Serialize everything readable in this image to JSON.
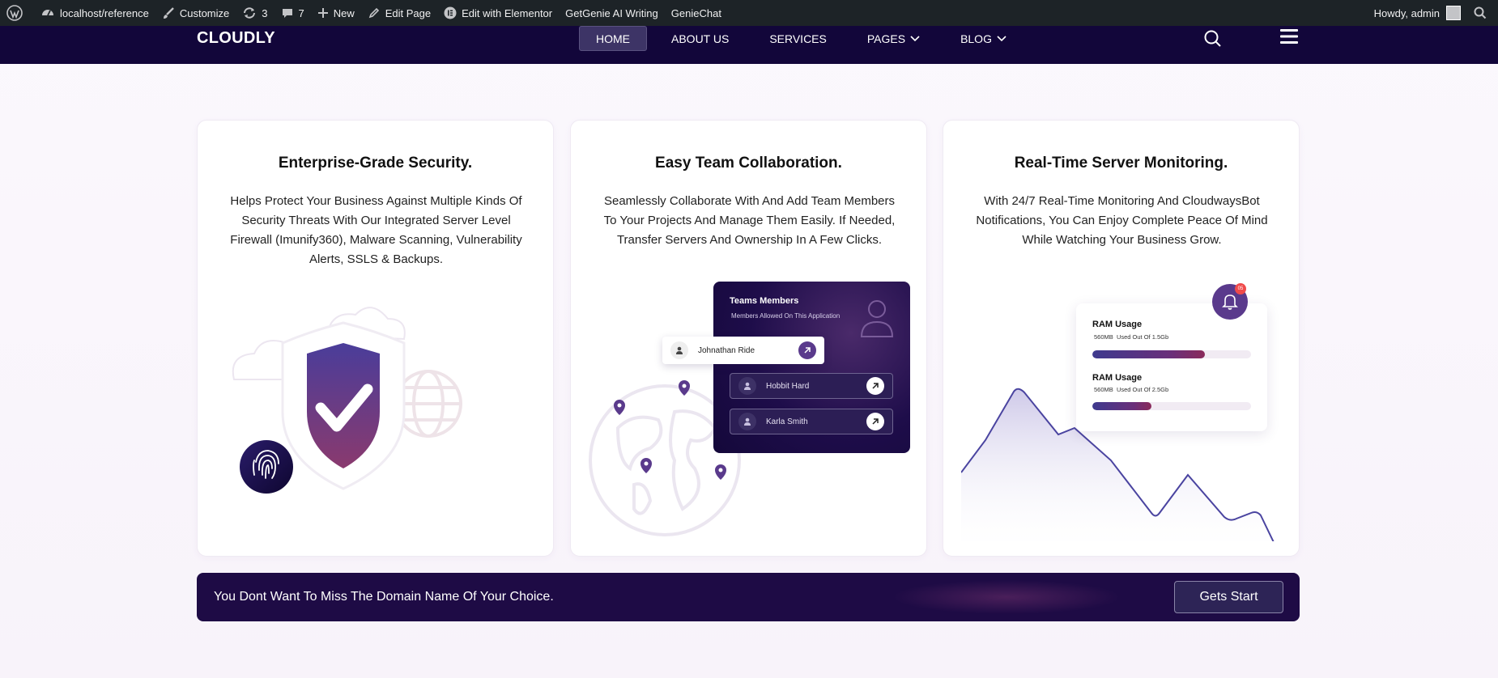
{
  "adminbar": {
    "site": "localhost/reference",
    "customize": "Customize",
    "updates_count": "3",
    "comments_count": "7",
    "new": "New",
    "edit_page": "Edit Page",
    "elementor": "Edit with Elementor",
    "getgenie": "GetGenie AI Writing",
    "geniechat": "GenieChat",
    "howdy": "Howdy, admin"
  },
  "header": {
    "logo": "CLOUDLY",
    "nav": [
      {
        "label": "HOME",
        "active": true
      },
      {
        "label": "ABOUT US"
      },
      {
        "label": "SERVICES"
      },
      {
        "label": "PAGES",
        "dropdown": true
      },
      {
        "label": "BLOG",
        "dropdown": true
      }
    ]
  },
  "cards": [
    {
      "title": "Enterprise-Grade Security.",
      "text": "Helps Protect Your Business Against Multiple Kinds Of Security Threats With Our Integrated Server Level Firewall (Imunify360), Malware Scanning, Vulnerability Alerts, SSLS & Backups."
    },
    {
      "title": "Easy Team Collaboration.",
      "text": "Seamlessly Collaborate With And Add Team Members To Your Projects And Manage Them Easily. If Needed, Transfer Servers And Ownership In A Few Clicks.",
      "panel": {
        "title": "Teams Members",
        "subtitle": "Members Allowed On This Application",
        "members": [
          "Johnathan Ride",
          "Hobbit Hard",
          "Karla Smith"
        ]
      }
    },
    {
      "title": "Real-Time Server Monitoring.",
      "text": "With 24/7 Real-Time Monitoring And CloudwaysBot Notifications, You Can Enjoy Complete Peace Of Mind While Watching Your Business Grow.",
      "notification_badge": "05",
      "ram": [
        {
          "label": "RAM Usage",
          "used": "560MB",
          "detail": "Used Out Of 1.5Gb",
          "fill": 0.71
        },
        {
          "label": "RAM Usage",
          "used": "560MB",
          "detail": "Used Out Of 2.5Gb",
          "fill": 0.37
        }
      ]
    }
  ],
  "banner": {
    "text": "You Dont Want To Miss The Domain Name Of Your Choice.",
    "button": "Gets Start"
  },
  "colors": {
    "header_bg": "#12063a",
    "accent": "#5a3a8c",
    "adminbar_bg": "#1d2327"
  }
}
